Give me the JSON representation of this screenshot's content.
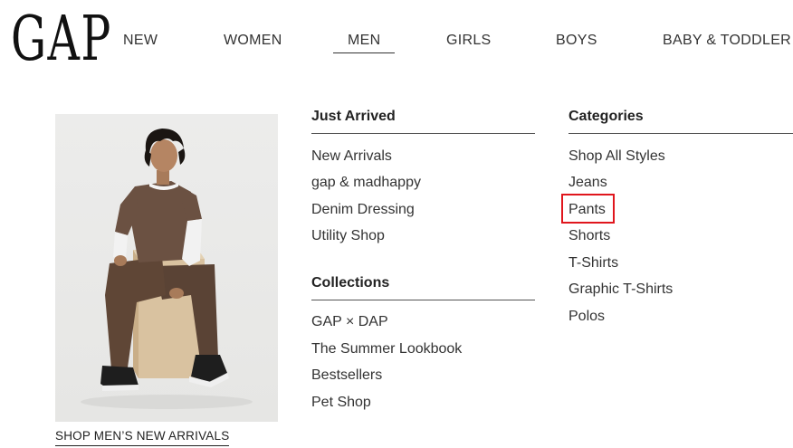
{
  "brand": {
    "logo_text": "GAP"
  },
  "nav": {
    "items": [
      {
        "label": "NEW"
      },
      {
        "label": "WOMEN"
      },
      {
        "label": "MEN",
        "active": true
      },
      {
        "label": "GIRLS"
      },
      {
        "label": "BOYS"
      },
      {
        "label": "BABY & TODDLER"
      }
    ]
  },
  "hero": {
    "link_label": "SHOP MEN’S NEW ARRIVALS"
  },
  "columns": {
    "just_arrived": {
      "heading": "Just Arrived",
      "links": [
        "New Arrivals",
        "gap & madhappy",
        "Denim Dressing",
        "Utility Shop"
      ]
    },
    "collections": {
      "heading": "Collections",
      "links": [
        "GAP × DAP",
        "The Summer Lookbook",
        "Bestsellers",
        "Pet Shop"
      ]
    },
    "categories": {
      "heading": "Categories",
      "links": [
        "Shop All Styles",
        "Jeans",
        "Pants",
        "Shorts",
        "T-Shirts",
        "Graphic T-Shirts",
        "Polos"
      ],
      "highlighted": "Pants"
    }
  },
  "colors": {
    "highlight_border": "#e0161d",
    "text": "#333333"
  }
}
